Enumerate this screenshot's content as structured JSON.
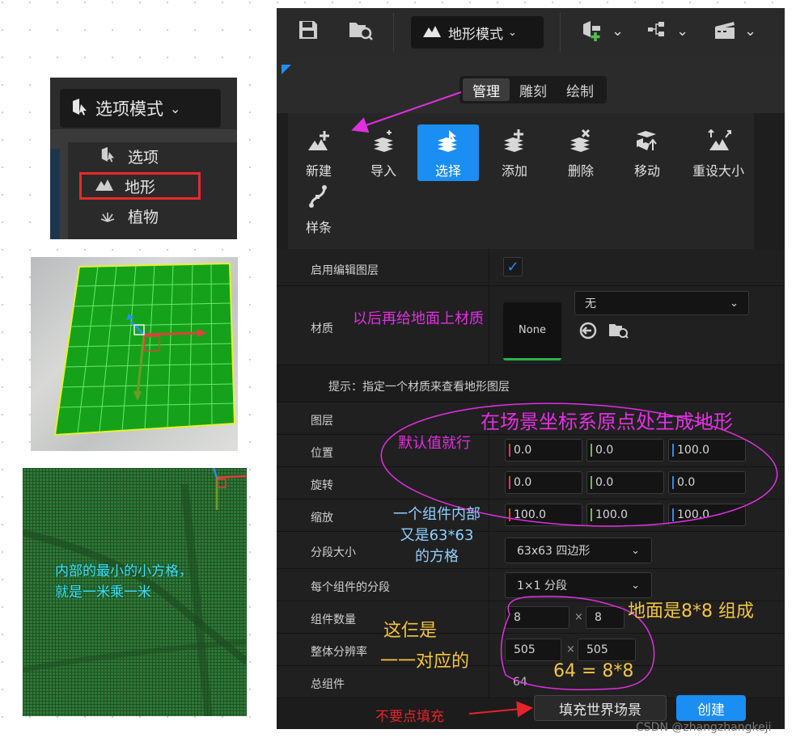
{
  "mode_dropdown": {
    "button_label": "选项模式",
    "items": [
      {
        "label": "选项",
        "icon": "select-mode-icon"
      },
      {
        "label": "地形",
        "icon": "landscape-icon"
      },
      {
        "label": "植物",
        "icon": "foliage-icon"
      }
    ]
  },
  "toolbar": {
    "mode_label": "地形模式"
  },
  "tabs": [
    "管理",
    "雕刻",
    "绘制"
  ],
  "tools": [
    {
      "label": "新建",
      "icon": "new-landscape-icon"
    },
    {
      "label": "导入",
      "icon": "import-icon"
    },
    {
      "label": "选择",
      "icon": "select-icon",
      "active": true
    },
    {
      "label": "添加",
      "icon": "add-icon"
    },
    {
      "label": "删除",
      "icon": "delete-icon"
    },
    {
      "label": "移动",
      "icon": "move-icon"
    },
    {
      "label": "重设大小",
      "icon": "resize-icon"
    },
    {
      "label": "样条",
      "icon": "spline-icon"
    }
  ],
  "properties": {
    "edit_layers_label": "启用编辑图层",
    "material_label": "材质",
    "material_thumb": "None",
    "material_value": "无",
    "hint": "提示：指定一个材质来查看地形图层",
    "layers_label": "图层",
    "location": {
      "label": "位置",
      "x": "0.0",
      "y": "0.0",
      "z": "100.0"
    },
    "rotation": {
      "label": "旋转",
      "x": "0.0",
      "y": "0.0",
      "z": "0.0"
    },
    "scale": {
      "label": "缩放",
      "x": "100.0",
      "y": "100.0",
      "z": "100.0"
    },
    "section_size": {
      "label": "分段大小",
      "value": "63x63 四边形"
    },
    "sections_per_component": {
      "label": "每个组件的分段",
      "value": "1×1 分段"
    },
    "component_count": {
      "label": "组件数量",
      "x": "8",
      "y": "8"
    },
    "overall_resolution": {
      "label": "整体分辨率",
      "x": "505",
      "y": "505"
    },
    "total_components": {
      "label": "总组件",
      "value": "64"
    },
    "times_symbol": "×"
  },
  "buttons": {
    "fill_world": "填充世界场景",
    "create": "创建"
  },
  "annotations": {
    "material_note": "以后再给地面上材质",
    "origin_note": "在场景坐标系原点处生成地形",
    "default_note": "默认值就行",
    "component_note": [
      "一个组件内部",
      "又是63*63",
      "的方格"
    ],
    "ground_note": "地面是8*8 组成",
    "correspond_note": [
      "这仨是",
      "一一对应的"
    ],
    "equation_note": "64 = 8*8",
    "no_fill_note": "不要点填充",
    "grid_note": [
      "内部的最小的小方格，",
      "就是一米乘一米"
    ]
  },
  "watermark": "CSDN @zhangzhangkeji",
  "colors": {
    "accent_blue": "#1a8ef2",
    "annotation_magenta": "#e030e0",
    "annotation_yellow": "#f5c542",
    "annotation_cyan": "#3ee0ff",
    "annotation_red": "#e8222a",
    "x_axis": "#e0413a",
    "y_axis": "#6cc04a",
    "z_axis": "#2a8ef0"
  }
}
